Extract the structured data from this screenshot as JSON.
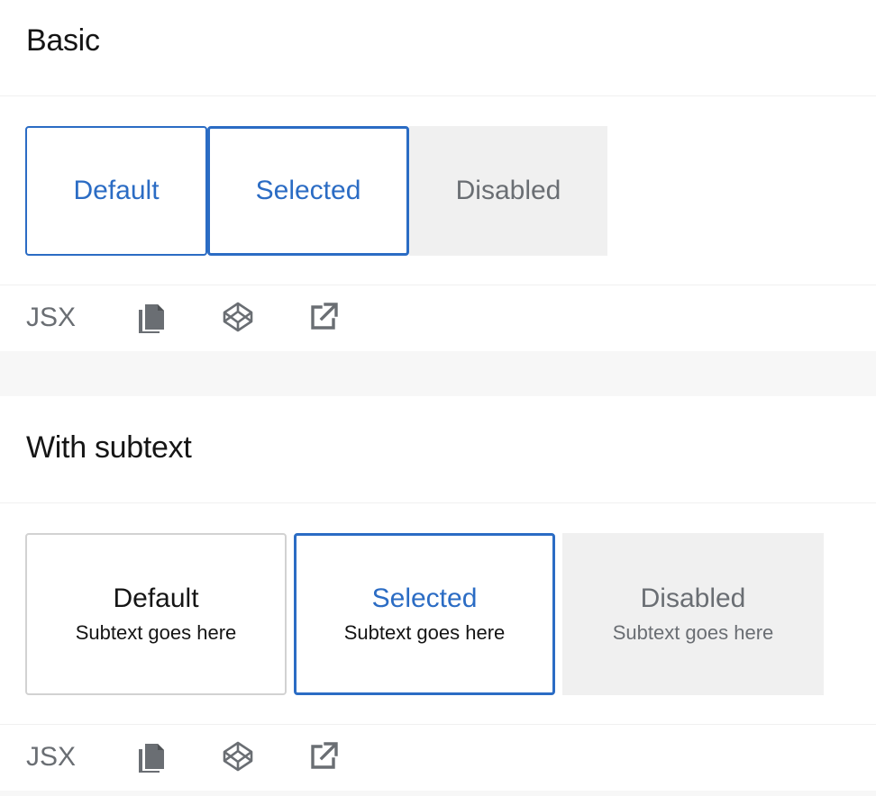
{
  "sections": [
    {
      "title": "Basic",
      "tiles": [
        {
          "title": "Default",
          "state": "default"
        },
        {
          "title": "Selected",
          "state": "selected"
        },
        {
          "title": "Disabled",
          "state": "disabled"
        }
      ],
      "toolbar": {
        "label": "JSX",
        "icons": [
          "copy-icon",
          "codepen-icon",
          "external-link-icon"
        ]
      }
    },
    {
      "title": "With subtext",
      "tiles": [
        {
          "title": "Default",
          "subtext": "Subtext goes here",
          "state": "default"
        },
        {
          "title": "Selected",
          "subtext": "Subtext goes here",
          "state": "selected"
        },
        {
          "title": "Disabled",
          "subtext": "Subtext goes here",
          "state": "disabled"
        }
      ],
      "toolbar": {
        "label": "JSX",
        "icons": [
          "copy-icon",
          "codepen-icon",
          "external-link-icon"
        ]
      }
    }
  ],
  "colors": {
    "accent": "#2b6cc4",
    "disabled_bg": "#f0f0f0",
    "muted_text": "#6a6e73",
    "band_bg": "#f7f7f7"
  }
}
